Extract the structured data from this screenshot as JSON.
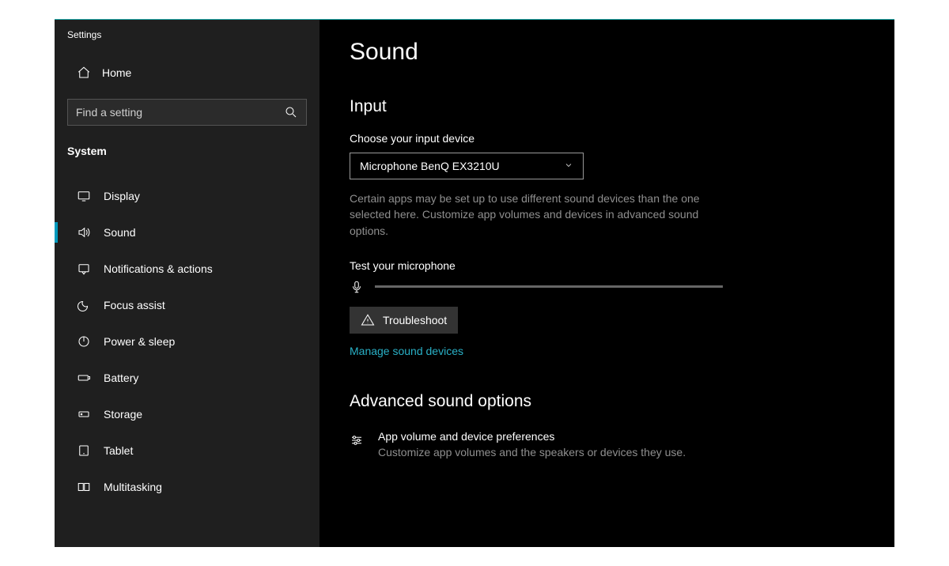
{
  "window": {
    "title": "Settings"
  },
  "sidebar": {
    "homeLabel": "Home",
    "searchPlaceholder": "Find a setting",
    "category": "System",
    "items": [
      {
        "id": "display",
        "label": "Display"
      },
      {
        "id": "sound",
        "label": "Sound"
      },
      {
        "id": "notifications",
        "label": "Notifications & actions"
      },
      {
        "id": "focus",
        "label": "Focus assist"
      },
      {
        "id": "power",
        "label": "Power & sleep"
      },
      {
        "id": "battery",
        "label": "Battery"
      },
      {
        "id": "storage",
        "label": "Storage"
      },
      {
        "id": "tablet",
        "label": "Tablet"
      },
      {
        "id": "multitasking",
        "label": "Multitasking"
      }
    ]
  },
  "main": {
    "pageTitle": "Sound",
    "input": {
      "heading": "Input",
      "chooseLabel": "Choose your input device",
      "selected": "Microphone BenQ EX3210U",
      "hint": "Certain apps may be set up to use different sound devices than the one selected here. Customize app volumes and devices in advanced sound options.",
      "testLabel": "Test your microphone",
      "troubleshoot": "Troubleshoot",
      "manageLink": "Manage sound devices"
    },
    "advanced": {
      "heading": "Advanced sound options",
      "itemTitle": "App volume and device preferences",
      "itemSub": "Customize app volumes and the speakers or devices they use."
    }
  }
}
